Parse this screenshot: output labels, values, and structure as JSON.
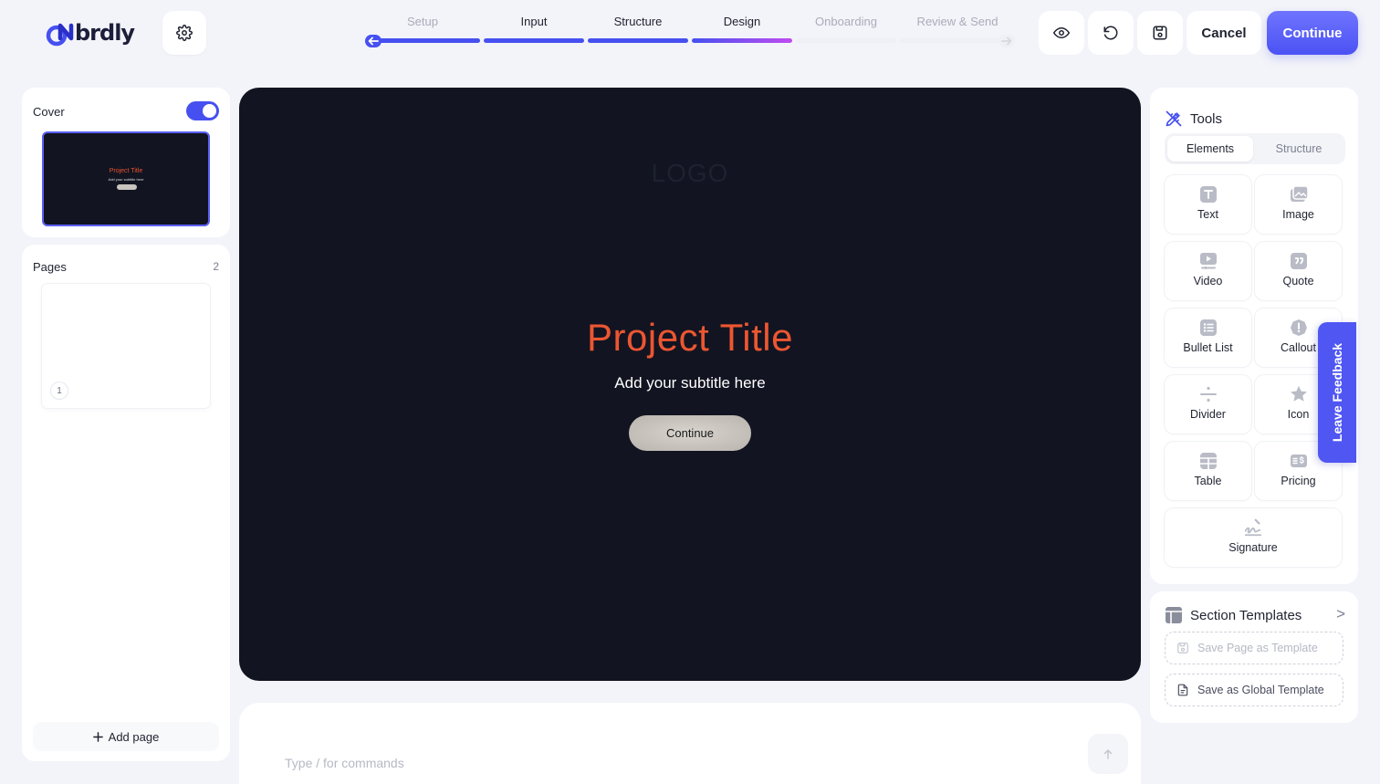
{
  "header": {
    "logo_text": "brdly",
    "steps": [
      {
        "label": "Setup",
        "state": "todo"
      },
      {
        "label": "Input",
        "state": "done"
      },
      {
        "label": "Structure",
        "state": "done"
      },
      {
        "label": "Design",
        "state": "current"
      },
      {
        "label": "Onboarding",
        "state": "todo"
      },
      {
        "label": "Review & Send",
        "state": "todo"
      }
    ],
    "cancel_label": "Cancel",
    "continue_label": "Continue"
  },
  "sidebar": {
    "cover_label": "Cover",
    "cover_enabled": true,
    "cover_thumb": {
      "title": "Project Title",
      "subtitle": "Add your subtitle here"
    },
    "pages_label": "Pages",
    "pages_count": "2",
    "page_thumbs": [
      {
        "number": "1"
      }
    ],
    "add_page_label": "Add page"
  },
  "canvas": {
    "logo": "LOGO",
    "title": "Project Title",
    "subtitle": "Add your subtitle here",
    "button_label": "Continue",
    "prompt_placeholder": "Type / for commands"
  },
  "tools": {
    "title": "Tools",
    "tabs": [
      {
        "label": "Elements",
        "active": true
      },
      {
        "label": "Structure",
        "active": false
      }
    ],
    "items": [
      {
        "label": "Text",
        "icon": "text-icon"
      },
      {
        "label": "Image",
        "icon": "image-icon"
      },
      {
        "label": "Video",
        "icon": "video-icon"
      },
      {
        "label": "Quote",
        "icon": "quote-icon"
      },
      {
        "label": "Bullet List",
        "icon": "bullet-list-icon"
      },
      {
        "label": "Callout",
        "icon": "callout-icon"
      },
      {
        "label": "Divider",
        "icon": "divider-icon"
      },
      {
        "label": "Icon",
        "icon": "star-icon"
      },
      {
        "label": "Table",
        "icon": "table-icon"
      },
      {
        "label": "Pricing",
        "icon": "pricing-icon"
      },
      {
        "label": "Signature",
        "icon": "signature-icon"
      }
    ]
  },
  "templates": {
    "title": "Section Templates",
    "save_page_label": "Save Page as Template",
    "save_global_label": "Save as Global Template"
  },
  "feedback": {
    "label": "Leave Feedback"
  },
  "colors": {
    "accent": "#4650f0",
    "title_orange": "#ec5631",
    "canvas_bg": "#121421",
    "step_gradient_end": "#c04cf0"
  }
}
